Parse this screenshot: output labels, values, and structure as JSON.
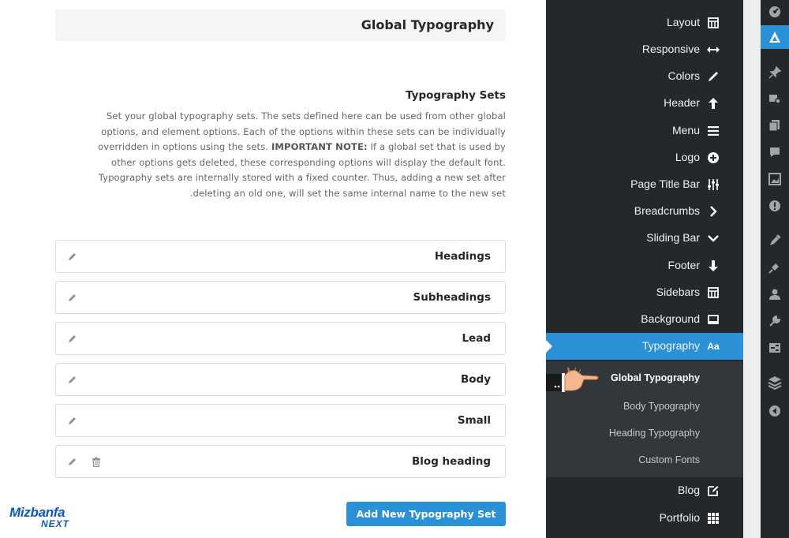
{
  "main": {
    "page_title": "Global Typography",
    "section_title": "Typography Sets",
    "description_lines": [
      "Set your global typography sets. The sets defined here can be used from other global",
      "options, and element options. Each of the options within these sets can be individually",
      "overridden in options using the sets.",
      "IMPORTANT NOTE:",
      "If a global set that is used by",
      "other options gets deleted, these corresponding options will display the default font.",
      "Typography sets are internally stored with a fixed counter. Thus, adding a new set after",
      ".deleting an old one, will set the same internal name to the new set"
    ],
    "sets": [
      {
        "label": "Headings"
      },
      {
        "label": "Subheadings"
      },
      {
        "label": "Lead"
      },
      {
        "label": "Body"
      },
      {
        "label": "Small"
      },
      {
        "label": "Blog heading",
        "deletable": true
      }
    ],
    "add_button": "Add New Typography Set",
    "icons": {
      "edit": "pencil-icon",
      "delete": "trash-icon"
    }
  },
  "brand": {
    "line1": "Mizbanfa",
    "line2": "NEXT"
  },
  "menu": {
    "items": [
      {
        "label": "Layout",
        "icon": "layout-icon"
      },
      {
        "label": "Responsive",
        "icon": "arrows-horizontal-icon"
      },
      {
        "label": "Colors",
        "icon": "brush-icon"
      },
      {
        "label": "Header",
        "icon": "arrow-up-icon"
      },
      {
        "label": "Menu",
        "icon": "menu-icon"
      },
      {
        "label": "Logo",
        "icon": "plus-circle-icon"
      },
      {
        "label": "Page Title Bar",
        "icon": "sliders-icon"
      },
      {
        "label": "Breadcrumbs",
        "icon": "chevron-right-icon"
      },
      {
        "label": "Sliding Bar",
        "icon": "chevron-down-icon"
      },
      {
        "label": "Footer",
        "icon": "arrow-down-icon"
      },
      {
        "label": "Sidebars",
        "icon": "sidebar-icon"
      },
      {
        "label": "Background",
        "icon": "background-icon"
      },
      {
        "label": "Typography",
        "icon": "typography-icon",
        "icon_text": "Aa",
        "active": true
      }
    ],
    "submenu": [
      {
        "label": "Global Typography",
        "current": true
      },
      {
        "label": "Body Typography"
      },
      {
        "label": "Heading Typography"
      },
      {
        "label": "Custom Fonts"
      }
    ],
    "after": [
      {
        "label": "Blog",
        "icon": "edit-icon"
      },
      {
        "label": "Portfolio",
        "icon": "grid-icon"
      }
    ]
  },
  "admin_bar": {
    "items": [
      {
        "icon": "dashboard-icon"
      },
      {
        "icon": "avada-icon",
        "active": true
      },
      {
        "icon": "pin-icon"
      },
      {
        "icon": "media-icon"
      },
      {
        "icon": "pages-icon"
      },
      {
        "icon": "comments-icon"
      },
      {
        "icon": "portfolio-image-icon"
      },
      {
        "icon": "alert-icon"
      },
      {
        "icon": "appearance-icon"
      },
      {
        "icon": "plugins-icon"
      },
      {
        "icon": "users-icon"
      },
      {
        "icon": "tools-icon"
      },
      {
        "icon": "settings-icon"
      },
      {
        "icon": "layers-icon"
      },
      {
        "icon": "collapse-icon"
      }
    ]
  },
  "colors": {
    "accent": "#2b91d7",
    "sidebar_bg": "#23282d",
    "submenu_bg": "#32373c",
    "brand": "#0b5bb5"
  }
}
